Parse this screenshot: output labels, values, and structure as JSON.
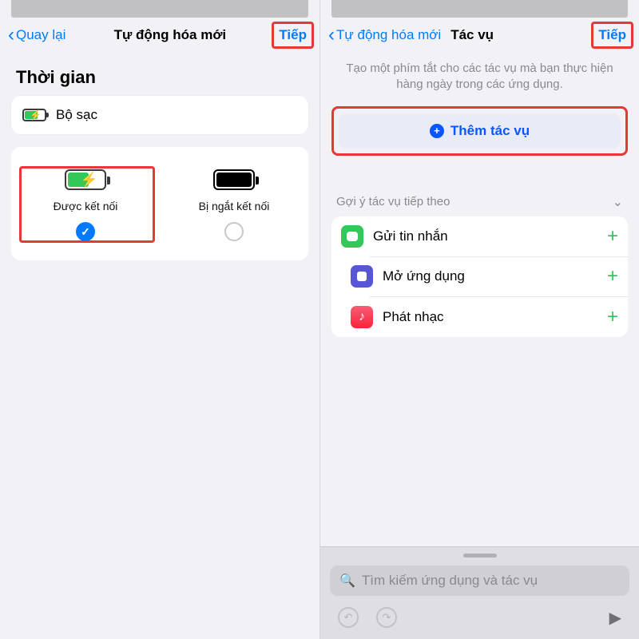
{
  "left": {
    "nav": {
      "back": "Quay lại",
      "title": "Tự động hóa mới",
      "next": "Tiếp"
    },
    "section_title": "Thời gian",
    "charger_row": "Bộ sạc",
    "choices": {
      "connected": "Được kết nối",
      "disconnected": "Bị ngắt kết nối"
    }
  },
  "right": {
    "nav": {
      "back": "Tự động hóa mới",
      "title": "Tác vụ",
      "next": "Tiếp"
    },
    "desc": "Tạo một phím tắt cho các tác vụ mà bạn thực hiện hàng ngày trong các ứng dụng.",
    "add_action": "Thêm tác vụ",
    "suggestion_header": "Gợi ý tác vụ tiếp theo",
    "items": {
      "msg": "Gửi tin nhắn",
      "open": "Mở ứng dụng",
      "music": "Phát nhạc"
    },
    "search_placeholder": "Tìm kiếm ứng dụng và tác vụ"
  }
}
